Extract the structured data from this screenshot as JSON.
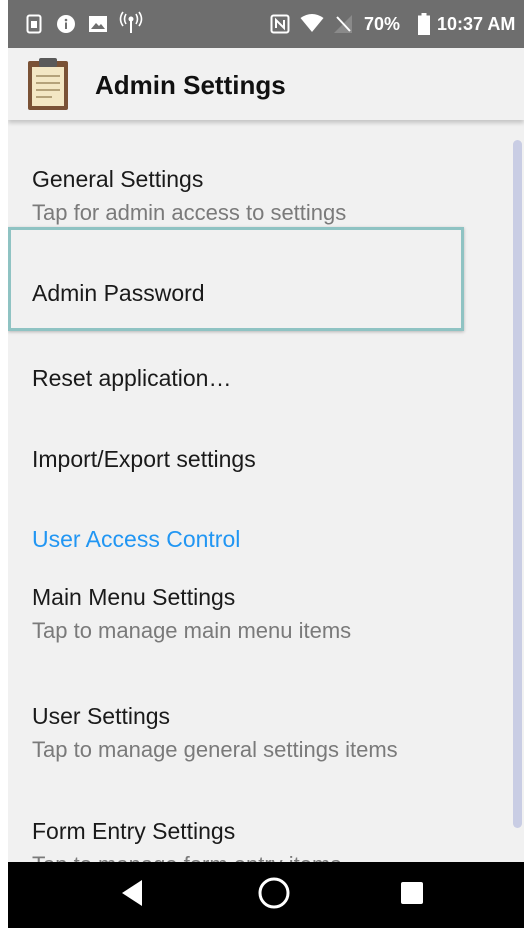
{
  "status_bar": {
    "icons_left": [
      "sim-icon",
      "info-icon",
      "image-icon",
      "broadcast-icon"
    ],
    "icons_right": [
      "nfc-icon",
      "wifi-icon",
      "signal-icon",
      "battery-icon"
    ],
    "battery_percent": "70%",
    "time": "10:37 AM"
  },
  "app_bar": {
    "icon": "clipboard-icon",
    "title": "Admin Settings"
  },
  "settings": {
    "general": {
      "title": "General Settings",
      "summary": "Tap for admin access to settings"
    },
    "admin_password": {
      "title": "Admin Password"
    },
    "reset": {
      "title": "Reset application…"
    },
    "import_export": {
      "title": "Import/Export settings"
    },
    "category": "User Access Control",
    "main_menu": {
      "title": "Main Menu Settings",
      "summary": "Tap to manage main menu items"
    },
    "user_settings": {
      "title": "User Settings",
      "summary": "Tap to manage general settings items"
    },
    "form_entry": {
      "title": "Form Entry Settings",
      "summary": "Tap to manage form entry items"
    }
  },
  "nav_bar": {
    "buttons": [
      "back-icon",
      "home-icon",
      "recents-icon"
    ]
  },
  "colors": {
    "status_bar": "#6e6e6e",
    "background": "#f1f1f1",
    "category_accent": "#2196f3",
    "highlight_border": "#8fc3c3",
    "scrollbar": "#c9cde4"
  }
}
